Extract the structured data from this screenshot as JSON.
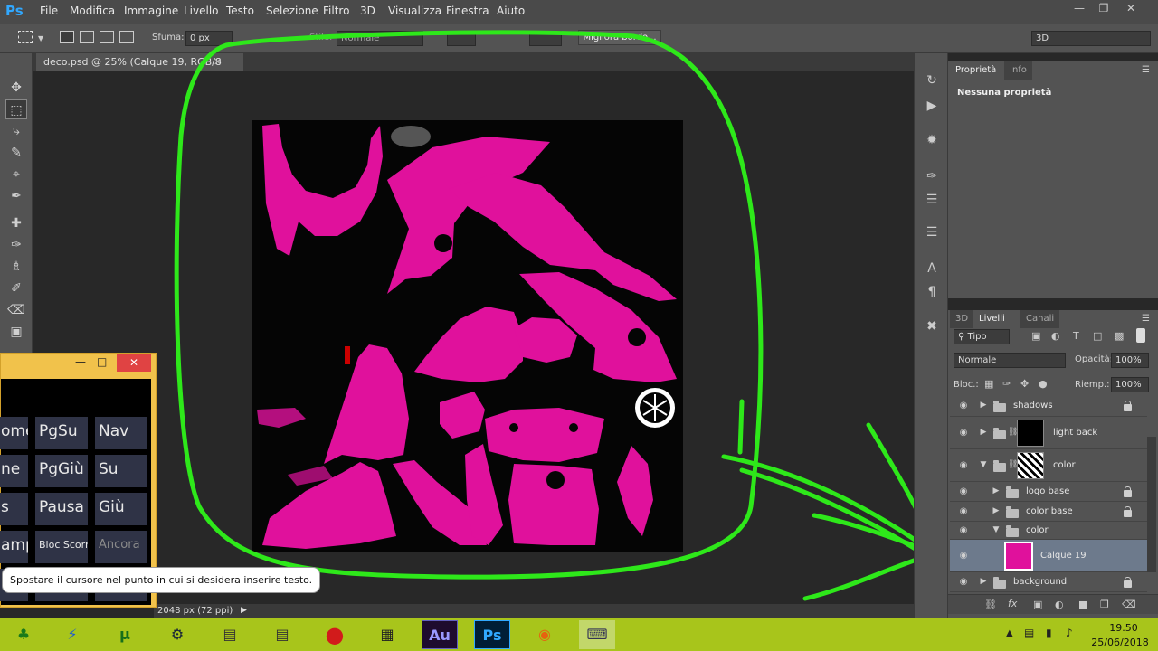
{
  "app": {
    "logo": "Ps"
  },
  "menu": [
    "File",
    "Modifica",
    "Immagine",
    "Livello",
    "Testo",
    "Selezione",
    "Filtro",
    "3D",
    "Visualizza",
    "Finestra",
    "Aiuto"
  ],
  "options": {
    "feather_label": "Sfuma:",
    "feather_value": "0 px",
    "style_label": "Stile:",
    "style_value": "Normale",
    "refine_edge": "Migliora bordo...",
    "workspace": "3D"
  },
  "document": {
    "tab_title": "deco.psd @ 25% (Calque 19, RGB/8",
    "status": "2048 px (72 ppi)"
  },
  "colors": {
    "accent_magenta": "#e0119c",
    "annotation_green": "#2ee81a",
    "taskbar_green": "#a8c51b"
  },
  "properties": {
    "tab_properties": "Proprietà",
    "tab_info": "Info",
    "empty_text": "Nessuna proprietà"
  },
  "layers_panel": {
    "tab_3d": "3D",
    "tab_layers": "Livelli",
    "tab_channels": "Canali",
    "filter": "Tipo",
    "blend_mode": "Normale",
    "opacity_label": "Opacità:",
    "opacity_value": "100%",
    "lock_label": "Bloc.:",
    "fill_label": "Riemp.:",
    "fill_value": "100%",
    "layers": [
      {
        "name": "shadows"
      },
      {
        "name": "light back"
      },
      {
        "name": "color"
      },
      {
        "name": "logo base"
      },
      {
        "name": "color base"
      },
      {
        "name": "color"
      },
      {
        "name": "Calque 19"
      },
      {
        "name": "background"
      }
    ]
  },
  "onscreen_keyboard": {
    "keys": [
      [
        "ome",
        "PgSu",
        "Nav"
      ],
      [
        "ne",
        "PgGiù",
        "Su"
      ],
      [
        "s",
        "Pausa",
        "Giù"
      ],
      [
        "amp",
        "Bloc Scorr",
        "Ancora"
      ]
    ]
  },
  "tooltip": "Spostare il cursore nel punto in cui si desidera inserire testo.",
  "taskbar": {
    "apps": [
      "clover",
      "thunder",
      "utorrent",
      "steam",
      "app-1",
      "app-2",
      "record",
      "film",
      "Au",
      "Ps",
      "firefox",
      "keyboard"
    ],
    "time": "19.50",
    "date": "25/06/2018"
  }
}
